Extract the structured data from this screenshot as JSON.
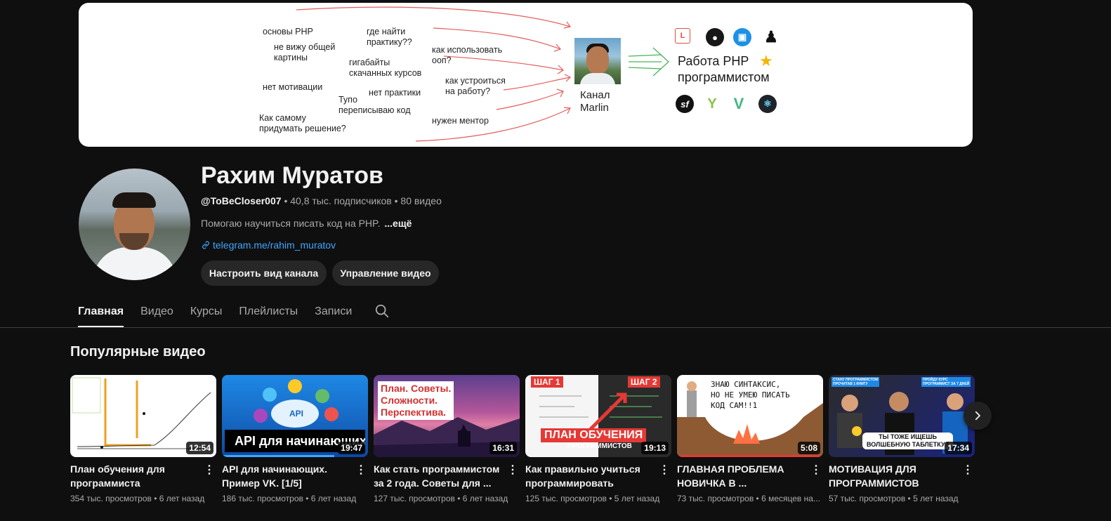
{
  "banner": {
    "phrases": [
      "основы PHP",
      "где найти\nпрактику??",
      "не вижу общей\nкартины",
      "как использовать\nооп?",
      "гигабайты\nскачанных курсов",
      "нет мотивации",
      "как устроиться\nна работу?",
      "нет практики",
      "Тупо\nпереписываю код",
      "Как самому\nпридумать решение?",
      "нужен ментор"
    ],
    "kanal": "Канал\nMarlin",
    "rabota": "Работа PHP\nпрограммистом"
  },
  "channel": {
    "title": "Рахим Муратов",
    "handle": "@ToBeCloser007",
    "subscribers": "40,8 тыс. подписчиков",
    "videos_count": "80 видео",
    "description": "Помогаю научиться писать код на PHP.",
    "more": "...ещё",
    "link": "telegram.me/rahim_muratov",
    "customize_button": "Настроить вид канала",
    "manage_button": "Управление видео"
  },
  "tabs": [
    "Главная",
    "Видео",
    "Курсы",
    "Плейлисты",
    "Записи"
  ],
  "section": {
    "title": "Популярные видео"
  },
  "videos": [
    {
      "title": "План обучения для программиста",
      "views": "354 тыс. просмотров",
      "age": "6 лет назад",
      "duration": "12:54"
    },
    {
      "title": "API для начинающих. Пример VK. [1/5]",
      "views": "186 тыс. просмотров",
      "age": "6 лет назад",
      "duration": "19:47",
      "thumb_text": "API для начинающих"
    },
    {
      "title": "Как стать программистом за 2 года. Советы для ...",
      "views": "127 тыс. просмотров",
      "age": "6 лет назад",
      "duration": "16:31",
      "thumb_text": "План. Советы.\nСложности.\nПерспектива."
    },
    {
      "title": "Как правильно учиться программировать",
      "views": "125 тыс. просмотров",
      "age": "5 лет назад",
      "duration": "19:13",
      "thumb_text": "ПЛАН ОБУЧЕНИЯ",
      "thumb_sub": "ПРОГРАММИСТОВ",
      "step1": "ШАГ 1",
      "step2": "ШАГ 2"
    },
    {
      "title": "ГЛАВНАЯ ПРОБЛЕМА НОВИЧКА В ...",
      "views": "73 тыс. просмотров",
      "age": "6 месяцев на...",
      "duration": "5:08",
      "thumb_text": "ЗНАЮ СИНТАКСИС,\nНО НЕ УМЕЮ ПИСАТЬ\nКОД САМ!!1"
    },
    {
      "title": "МОТИВАЦИЯ ДЛЯ ПРОГРАММИСТОВ",
      "views": "57 тыс. просмотров",
      "age": "5 лет назад",
      "duration": "17:34",
      "thumb_text": "ТЫ ТОЖЕ ИЩЕШЬ\nВОЛШЕБНУЮ ТАБЛЕТКУ?",
      "badge_left": "СТАНУ ПРОГРАММИСТОМ\nПРОЧИТАВ 1 КНИГУ",
      "badge_right": "ПРОЙДУ КУРС\nПРОГРАММИСТ ЗА 7 ДНЕЙ"
    }
  ],
  "colors": {
    "accent_link": "#3ea6ff",
    "background": "#0f0f0f",
    "button_bg": "#272727"
  }
}
